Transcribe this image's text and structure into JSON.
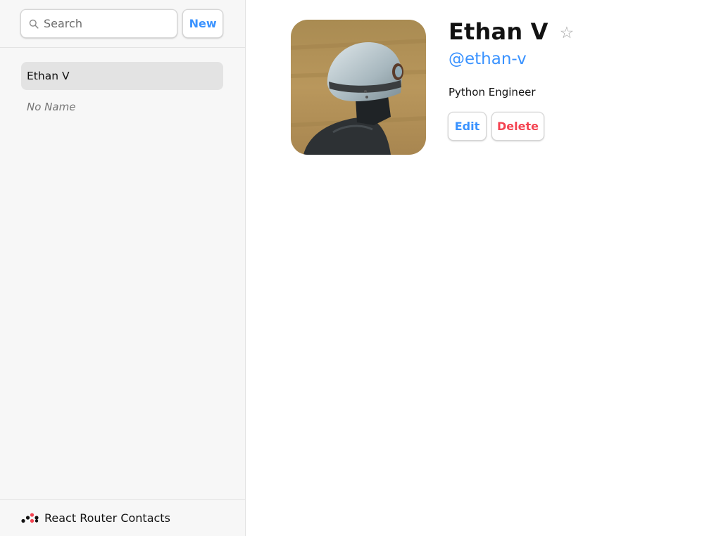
{
  "sidebar": {
    "search": {
      "placeholder": "Search",
      "value": ""
    },
    "new_label": "New",
    "contacts": [
      {
        "label": "Ethan V",
        "active": true
      },
      {
        "label": "No Name",
        "active": false
      }
    ],
    "footer_title": "React Router Contacts"
  },
  "contact": {
    "name": "Ethan V",
    "favorite_glyph": "☆",
    "twitter": "@ethan-v",
    "notes": "Python Engineer",
    "edit_label": "Edit",
    "delete_label": "Delete",
    "avatar_icon": "contact-photo-helmet"
  },
  "colors": {
    "accent": "#3992ff",
    "danger": "#f44250",
    "sidebar_bg": "#f7f7f7",
    "active_item_bg": "#e3e3e3"
  }
}
